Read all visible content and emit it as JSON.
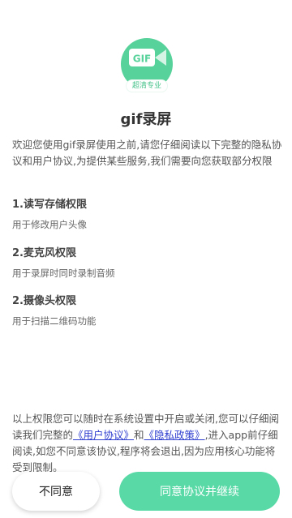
{
  "logo": {
    "icon_text": "GIF",
    "badge": "超清专业"
  },
  "title": "gif录屏",
  "intro": "欢迎您使用gif录屏使用之前,请您仔细阅读以下完整的隐私协议和用户协议,为提供某些服务,我们需要向您获取部分权限",
  "permissions": [
    {
      "title": "1.读写存储权限",
      "desc": "用于修改用户头像"
    },
    {
      "title": "2.麦克风权限",
      "desc": "用于录屏时同时录制音频"
    },
    {
      "title": "2.摄像头权限",
      "desc": "用于扫描二维码功能"
    }
  ],
  "footer": {
    "part1": "以上权限您可以随时在系统设置中开启或关闭,您可以仔细阅读我们完整的",
    "link_user": "《用户协议》",
    "and": "和",
    "link_privacy": "《隐私政策》",
    "part2": ",进入app前仔细阅读,如您不同意该协议,程序将会退出,因为应用核心功能将受到限制。"
  },
  "buttons": {
    "decline": "不同意",
    "agree": "同意协议并继续"
  },
  "colors": {
    "accent": "#58d9a6",
    "logo": "#58d29b",
    "link": "#2f3fcf"
  }
}
